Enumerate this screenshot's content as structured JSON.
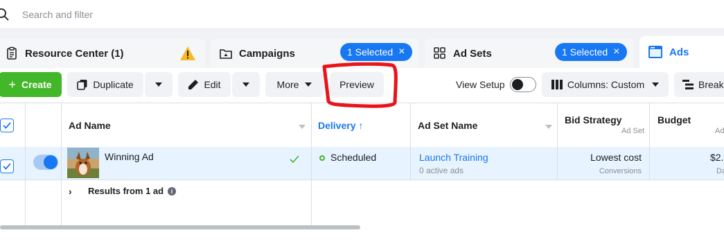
{
  "search": {
    "placeholder": "Search and filter"
  },
  "tabs": [
    {
      "label": "Resource Center (1)",
      "icon": "clipboard-icon",
      "warning_icon": "warning-icon"
    },
    {
      "label": "Campaigns",
      "icon": "folder-icon",
      "selected_label": "1 Selected"
    },
    {
      "label": "Ad Sets",
      "icon": "grid-icon",
      "selected_label": "1 Selected"
    },
    {
      "label": "Ads",
      "icon": "ad-window-icon",
      "active": true
    }
  ],
  "toolbar": {
    "create_label": "Create",
    "duplicate_label": "Duplicate",
    "edit_label": "Edit",
    "more_label": "More",
    "preview_label": "Preview",
    "view_setup_label": "View Setup",
    "columns_label": "Columns: Custom",
    "breakdown_label": "Breakd"
  },
  "table": {
    "headers": {
      "ad_name": "Ad Name",
      "delivery": "Delivery",
      "ad_set_name": "Ad Set Name",
      "bid_strategy": "Bid Strategy",
      "bid_strategy_sub": "Ad Set",
      "budget": "Budget",
      "budget_sub": "Ad"
    },
    "rows": [
      {
        "ad_name": "Winning Ad",
        "delivery": "Scheduled",
        "ad_set_name": "Launch Training",
        "ad_set_sub": "0 active ads",
        "bid_strategy": "Lowest cost",
        "bid_strategy_sub": "Conversions",
        "budget": "$2.",
        "budget_sub": "Da"
      }
    ],
    "results_label": "Results from 1 ad"
  },
  "colors": {
    "accent": "#1877f2",
    "create_green": "#42b72a",
    "annotation_red": "#e8141b",
    "warning_yellow": "#f7b928"
  }
}
